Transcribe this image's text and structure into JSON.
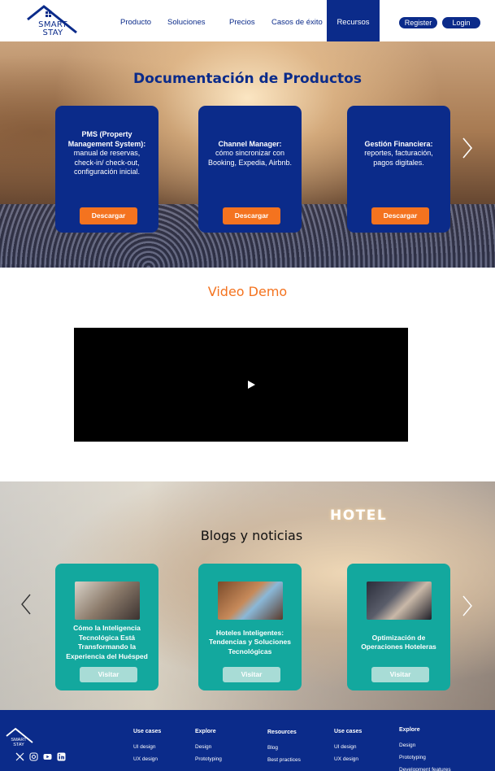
{
  "brand": {
    "line1": "SMART",
    "line2": "STAY",
    "color": "#0b2b8a",
    "accent": "#f4731f",
    "teal": "#13a89e"
  },
  "nav": {
    "items": [
      "Producto",
      "Soluciones",
      "Precios",
      "Casos de éxito",
      "Recursos"
    ],
    "active": "Recursos",
    "register": "Register",
    "login": "Login"
  },
  "hero": {
    "title": "Documentación de Productos",
    "cards": [
      {
        "title": "PMS (Property Management System):",
        "desc": "manual de reservas, check-in/ check-out, configuración inicial.",
        "button": "Descargar"
      },
      {
        "title": "Channel Manager:",
        "desc": "cómo sincronizar con Booking, Expedia, Airbnb.",
        "button": "Descargar"
      },
      {
        "title": "Gestión Financiera:",
        "desc": "reportes, facturación, pagos digitales.",
        "button": "Descargar"
      }
    ]
  },
  "video": {
    "title": "Video Demo"
  },
  "blogs": {
    "sign": "HOTEL",
    "title": "Blogs y noticias",
    "cards": [
      {
        "title": "Cómo la Inteligencia Tecnológica Está Transformando la Experiencia del Huésped",
        "button": "Visitar"
      },
      {
        "title": "Hoteles Inteligentes: Tendencias y Soluciones Tecnológicas",
        "button": "Visitar"
      },
      {
        "title": "Optimización de Operaciones Hoteleras",
        "button": "Visitar"
      }
    ]
  },
  "footer": {
    "logo_line1": "SMART",
    "logo_line2": "STAY",
    "social_icons": [
      "x-icon",
      "instagram-icon",
      "youtube-icon",
      "linkedin-icon"
    ],
    "columns": [
      {
        "heading": "Use cases",
        "items": [
          "UI design",
          "UX design"
        ]
      },
      {
        "heading": "Explore",
        "items": [
          "Design",
          "Prototyping"
        ]
      },
      {
        "heading": "Resources",
        "items": [
          "Blog",
          "Best practices"
        ]
      },
      {
        "heading": "Use cases",
        "items": [
          "UI design",
          "UX design"
        ]
      },
      {
        "heading": "Explore",
        "items": [
          "Design",
          "Prototyping",
          "Development features"
        ]
      }
    ]
  }
}
